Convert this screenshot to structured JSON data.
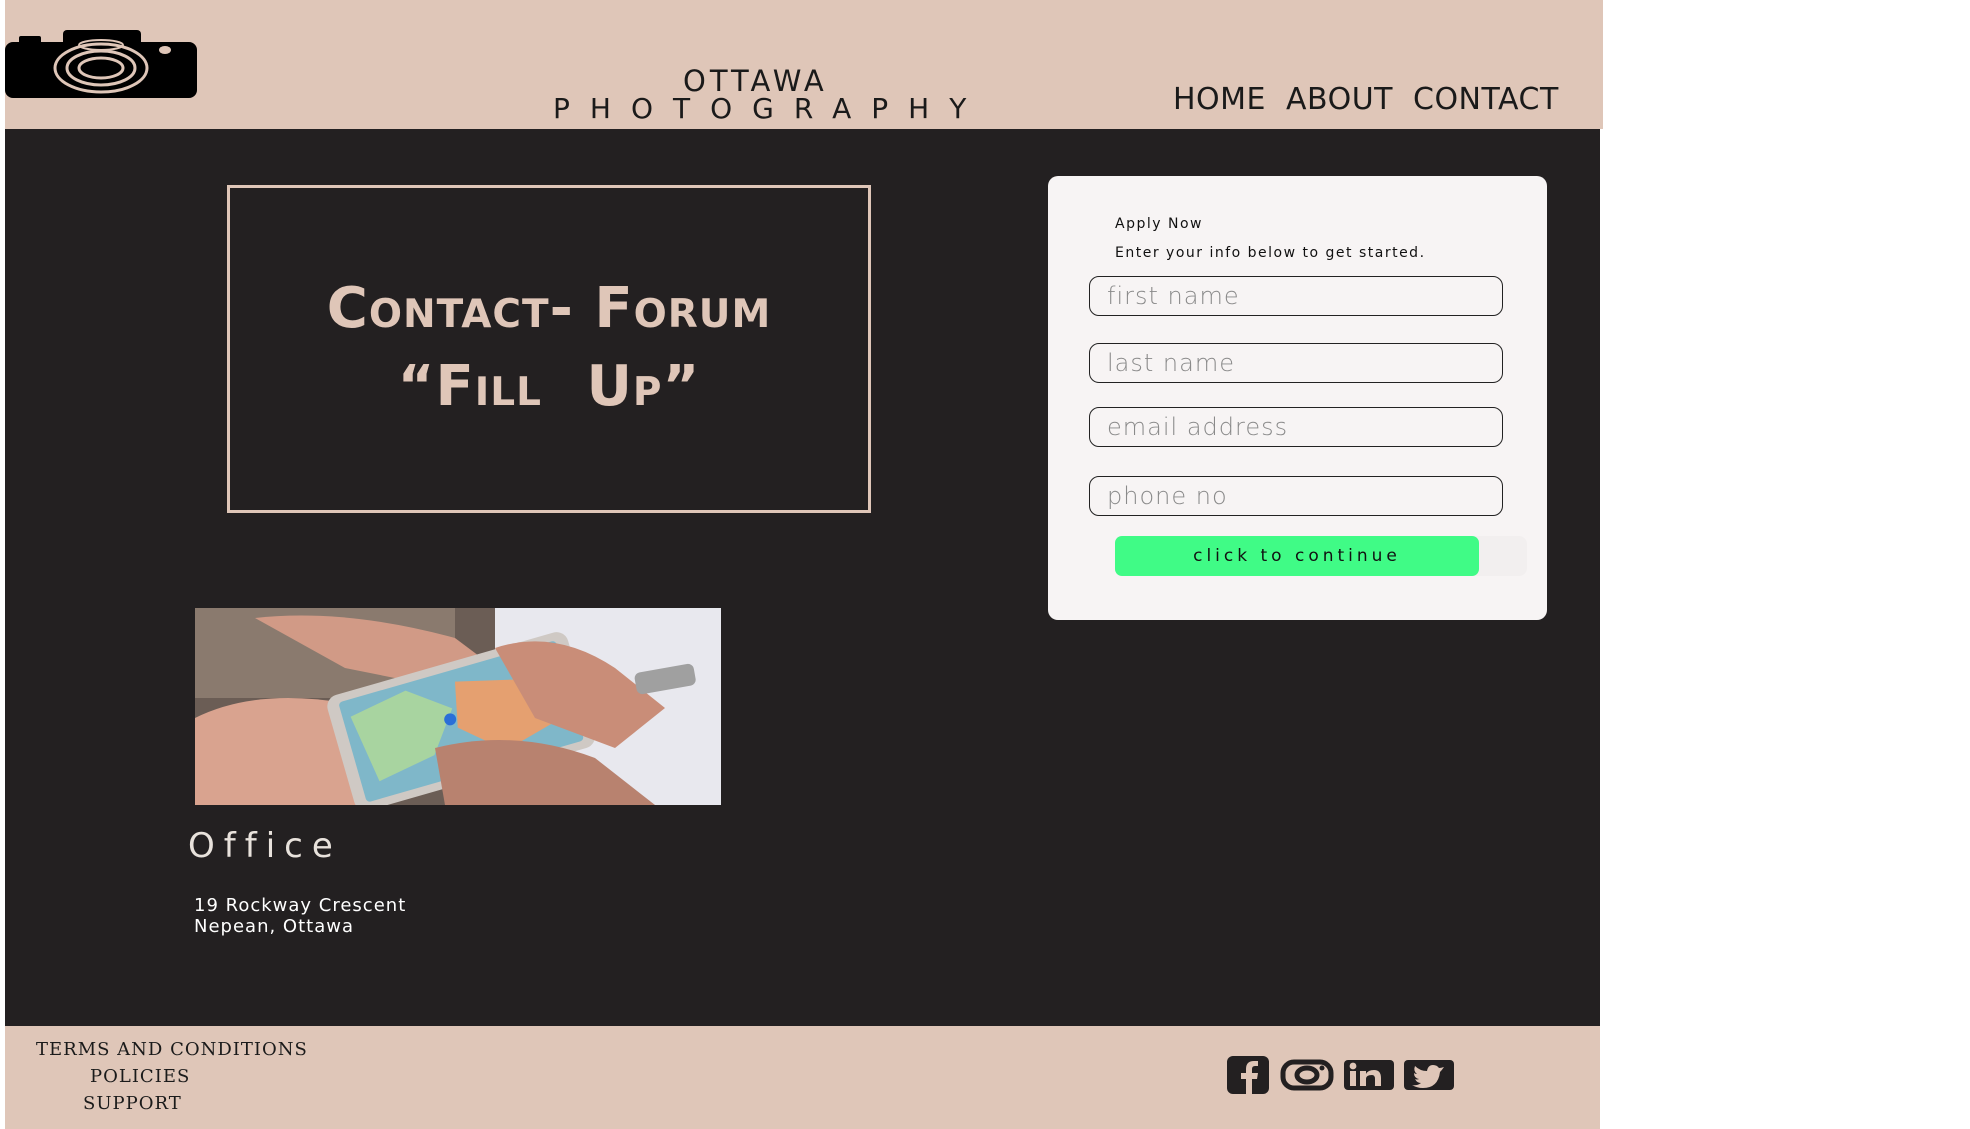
{
  "header": {
    "brand_line1": "OTTAWA",
    "brand_line2": "PHOTOGRAPHY",
    "nav": [
      "HOME",
      "ABOUT",
      "CONTACT"
    ]
  },
  "hero": {
    "line1": "Contact- Forum",
    "line2": "“Fill Up”"
  },
  "office": {
    "title": "Office",
    "address_line1": "19 Rockway Crescent",
    "address_line2": "Nepean, Ottawa"
  },
  "form": {
    "title": "Apply Now",
    "subtitle": "Enter your info below to get started.",
    "first_name_placeholder": "first name",
    "last_name_placeholder": "last name",
    "email_placeholder": "email address",
    "phone_placeholder": "phone no",
    "submit_label": "click to continue"
  },
  "footer": {
    "links": [
      "TERMS AND CONDITIONS",
      "POLICIES",
      "SUPPORT"
    ],
    "social_icons": [
      "facebook-icon",
      "instagram-icon",
      "linkedin-icon",
      "twitter-icon"
    ]
  },
  "colors": {
    "beige": "#dfc6b8",
    "dark": "#232021",
    "accent_green": "#40fb86"
  }
}
